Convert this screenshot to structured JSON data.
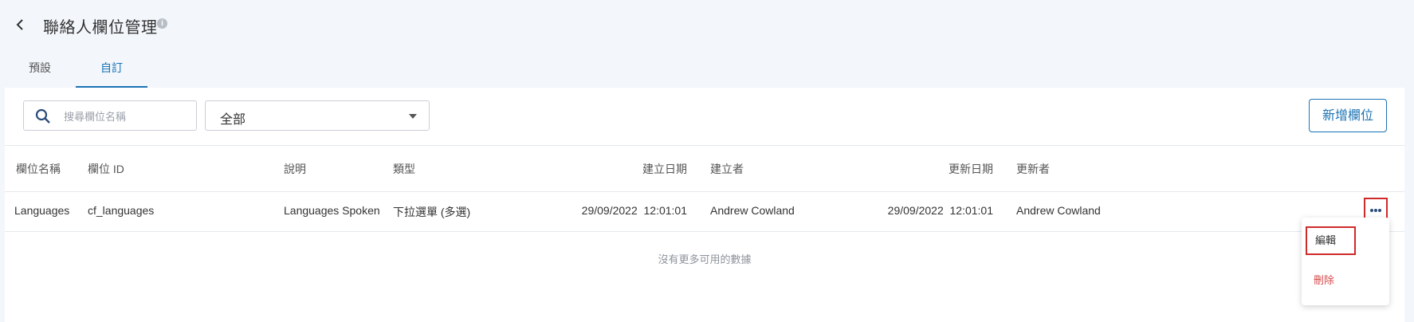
{
  "header": {
    "title": "聯絡人欄位管理",
    "info_icon": "info-icon"
  },
  "tabs": [
    {
      "label": "預設",
      "active": false
    },
    {
      "label": "自訂",
      "active": true
    }
  ],
  "toolbar": {
    "search_placeholder": "搜尋欄位名稱",
    "filter_value": "全部",
    "add_button": "新增欄位"
  },
  "table": {
    "columns": {
      "name": "欄位名稱",
      "id": "欄位 ID",
      "description": "說明",
      "type": "類型",
      "created_date": "建立日期",
      "creator": "建立者",
      "updated_date": "更新日期",
      "updater": "更新者"
    },
    "rows": [
      {
        "name": "Languages",
        "id": "cf_languages",
        "description": "Languages Spoken",
        "type": "下拉選單 (多選)",
        "created_date": "29/09/2022  12:01:01",
        "creator": "Andrew Cowland",
        "updated_date": "29/09/2022  12:01:01",
        "updater": "Andrew Cowland"
      }
    ],
    "empty_message": "沒有更多可用的數據"
  },
  "row_menu": {
    "edit": "編輯",
    "delete": "刪除"
  },
  "colors": {
    "accent": "#1a73b5",
    "highlight": "#cf2a2a",
    "danger": "#d44a4a"
  }
}
